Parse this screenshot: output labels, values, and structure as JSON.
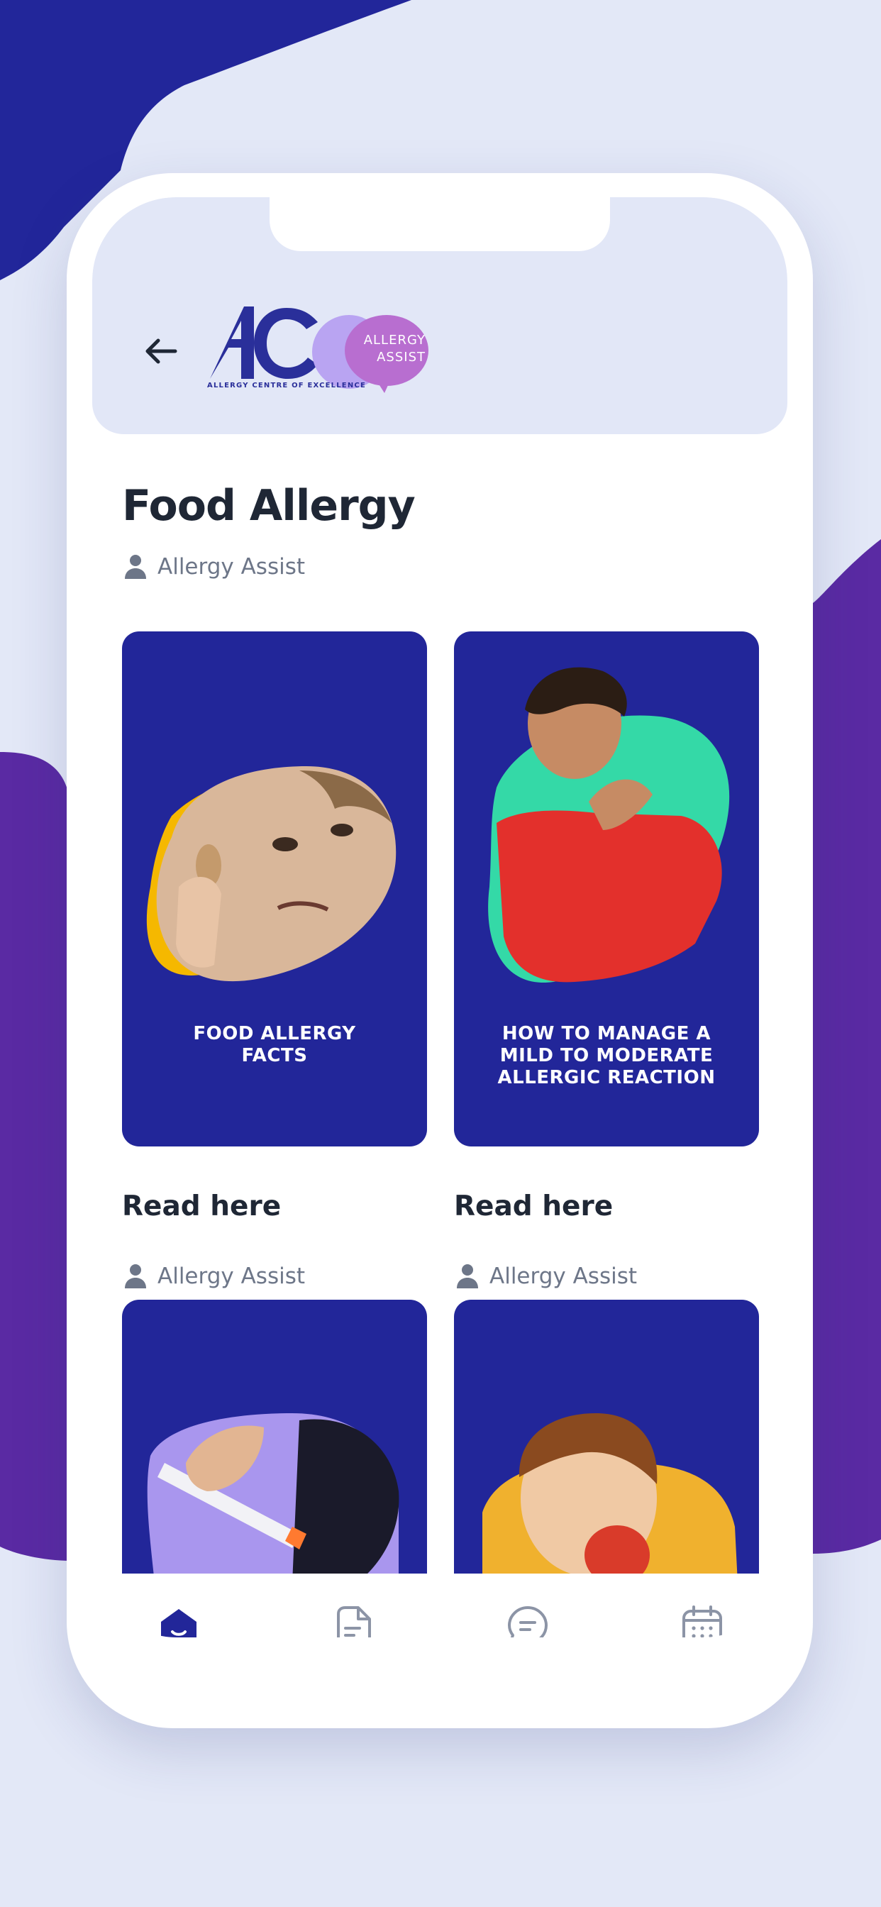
{
  "colors": {
    "accent": "#222699",
    "purple": "#5a2aa3",
    "background": "#e3e8f7",
    "text": "#1f2735",
    "muted": "#6d7688"
  },
  "header": {
    "back_icon": "arrow-left-icon",
    "logo": {
      "mark": "AC",
      "subtitle": "ALLERGY CENTRE OF EXCELLENCE",
      "bubble_line1": "ALLERGY",
      "bubble_line2": "ASSIST"
    }
  },
  "page": {
    "title": "Food Allergy",
    "author": "Allergy Assist"
  },
  "cards": [
    {
      "caption": "FOOD ALLERGY\nFACTS",
      "title": "Read here",
      "author": "Allergy Assist"
    },
    {
      "caption": "HOW TO MANAGE A\nMILD TO MODERATE\nALLERGIC REACTION",
      "title": "Read here",
      "author": "Allergy Assist"
    },
    {
      "caption": "",
      "title": "",
      "author": ""
    },
    {
      "caption": "",
      "title": "",
      "author": ""
    }
  ],
  "tabbar": [
    {
      "icon": "home-icon",
      "active": true
    },
    {
      "icon": "document-icon",
      "active": false
    },
    {
      "icon": "chat-icon",
      "active": false
    },
    {
      "icon": "calendar-icon",
      "active": false
    }
  ]
}
